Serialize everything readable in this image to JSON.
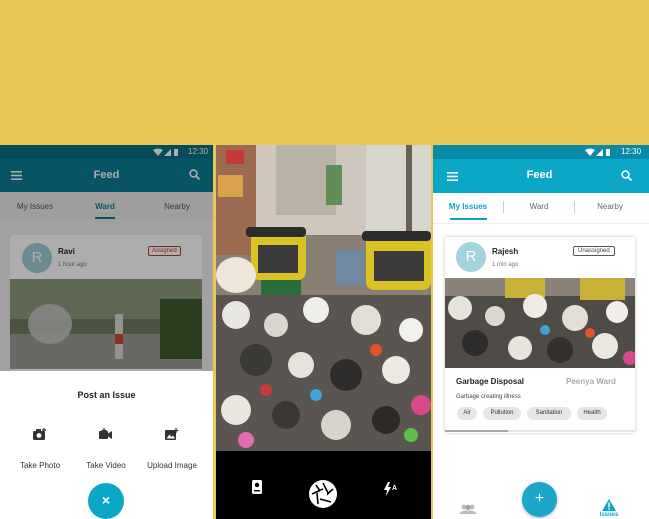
{
  "status": {
    "time": "12:30"
  },
  "left_panel": {
    "title": "Feed",
    "tabs": [
      {
        "label": "My Issues"
      },
      {
        "label": "Ward"
      },
      {
        "label": "Nearby"
      }
    ],
    "post": {
      "avatar_letter": "R",
      "user": "Ravi",
      "time": "1 hour ago",
      "badge": "Assigned"
    },
    "sheet": {
      "title": "Post an Issue",
      "actions": [
        {
          "label": "Take Photo",
          "icon": "camera-plus-icon"
        },
        {
          "label": "Take Video",
          "icon": "video-plus-icon"
        },
        {
          "label": "Upload Image",
          "icon": "image-plus-icon"
        }
      ],
      "close_symbol": "×"
    }
  },
  "camera_panel": {
    "controls": [
      {
        "icon": "switch-camera-icon"
      },
      {
        "icon": "shutter-icon"
      },
      {
        "icon": "flash-auto-icon"
      }
    ]
  },
  "right_panel": {
    "title": "Feed",
    "tabs": [
      {
        "label": "My Issues"
      },
      {
        "label": "Ward"
      },
      {
        "label": "Nearby"
      }
    ],
    "post": {
      "avatar_letter": "R",
      "user": "Rajesh",
      "time": "1 min ago",
      "badge": "Unassigned",
      "issue_title": "Garbage Disposal",
      "location": "Peenya Ward",
      "description": "Garbage creating illness",
      "tags": [
        "Air",
        "Pollution",
        "Sanitation",
        "Health"
      ]
    },
    "fab_symbol": "+",
    "bottom_nav": {
      "active_label": "Issues"
    }
  },
  "colors": {
    "background": "#E8C759",
    "primary": "#0CA6C6",
    "accent": "#1AA7C9",
    "badge_red": "#C0392B"
  }
}
